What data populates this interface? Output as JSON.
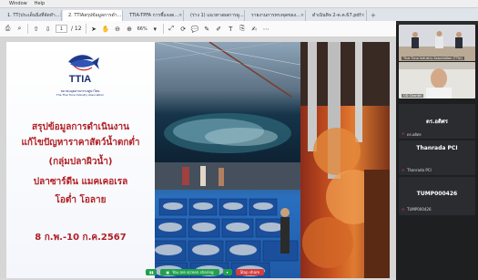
{
  "window": {
    "menu": [
      "Window",
      "Help"
    ]
  },
  "tabs": [
    {
      "label": "1. TT(ประเด็นนิ่งที่จัดทำ...",
      "active": false
    },
    {
      "label": "2. TTIAสรุปข้อมูลการดำ...",
      "active": true
    },
    {
      "label": "TTIA-TPFA การชี้แจงด...",
      "active": false
    },
    {
      "label": "(ร่าง 1) แนวทางผลการดู...",
      "active": false
    },
    {
      "label": "รายงานการทรงจุดของ...",
      "active": false
    },
    {
      "label": "ดำเนินทิจ 2-ค.ค.67.pdf",
      "active": false
    }
  ],
  "toolbar": {
    "page_current": "1",
    "page_total": "/ 12",
    "zoom": "66%"
  },
  "slide": {
    "org_name_th": "สมาคมอุตสาหกรรมทูน่าไทย",
    "org_name_en": "The Thai Tuna Industry Association",
    "logo_text": "TTIA",
    "title_line1": "สรุปข้อมูลการดำเนินงาน",
    "title_line2": "แก้ไขปัญหาราคาสัตว์น้ำตกต่ำ",
    "title_line3": "(กลุ่มปลาผิวน้ำ)",
    "title_line4": "ปลาซาร์ดีน แมคเคอเรล",
    "title_line5": "โอต่ำ โอลาย",
    "date_range": "8 ก.พ.-10 ก.ค.2567"
  },
  "meeting": {
    "video1_label": "Thai Tuna Industry Association (TTIA)",
    "video2_label": "OD Chanthi",
    "tile1_name": "ดร.อดิศร",
    "tile1_sub": "ดร.อดิศร",
    "tile2_name": "Thanrada PCI",
    "tile2_sub": "Thanrada PCI",
    "tile3_name": "TUMP000426",
    "tile3_sub": "TUMP000426"
  },
  "status": {
    "sharing_text": "You are screen sharing",
    "stop_label": "Stop share"
  },
  "colors": {
    "title_red": "#b11f24",
    "share_green": "#1fa14b",
    "stop_red": "#d93a3a"
  }
}
